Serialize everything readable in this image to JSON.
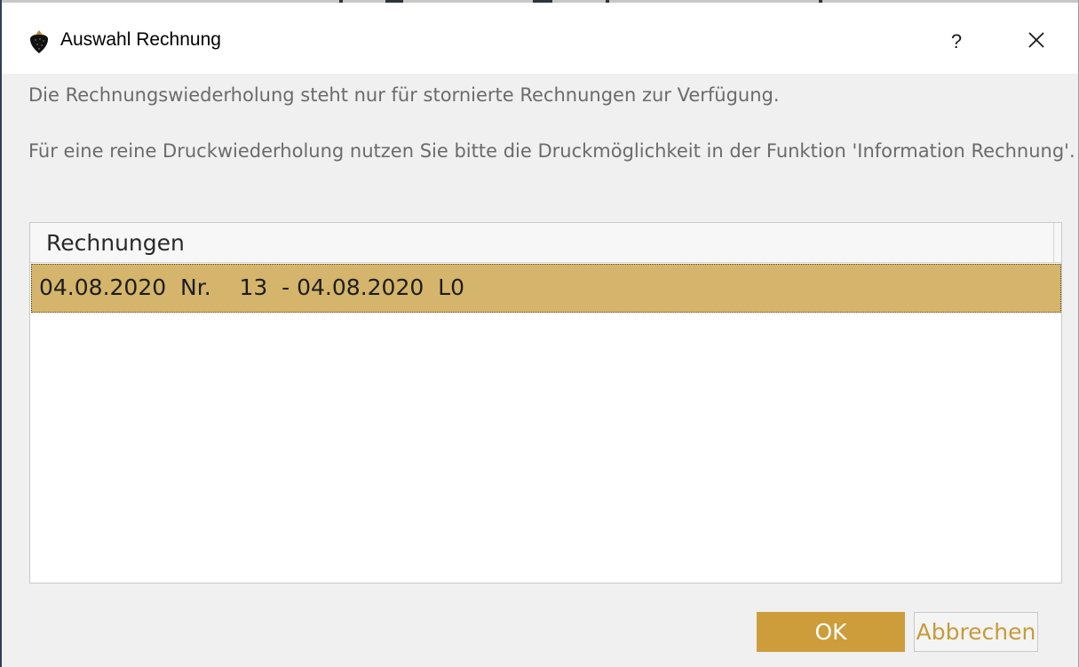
{
  "window": {
    "title": "Auswahl Rechnung",
    "help_glyph": "?",
    "close_glyph": "×",
    "app_icon": "strawberry-icon"
  },
  "messages": {
    "line1": "Die Rechnungswiederholung steht nur für stornierte Rechnungen zur Verfügung.",
    "line2": "Für eine reine Druckwiederholung nutzen Sie bitte die Druckmöglichkeit in der Funktion 'Information Rechnung'."
  },
  "invoice_list": {
    "header": "Rechnungen",
    "rows": [
      {
        "text": "04.08.2020  Nr.    13  - 04.08.2020  L0",
        "selected": true
      }
    ]
  },
  "buttons": {
    "ok_label": "OK",
    "cancel_label": "Abbrechen"
  },
  "colors": {
    "accent": "#cc9d3a",
    "selection": "#d4b56b",
    "dialog_background": "#f0f0f0",
    "message_text": "#6b6b6b"
  }
}
